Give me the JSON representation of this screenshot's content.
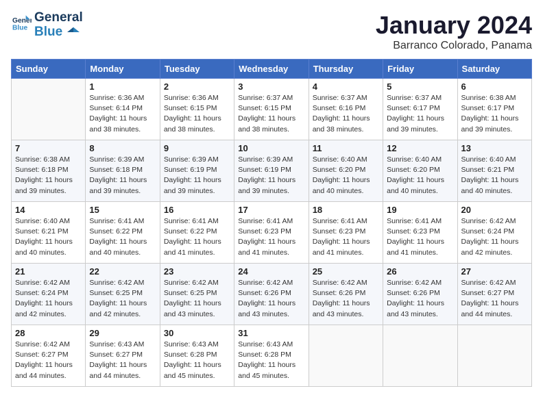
{
  "header": {
    "logo_line1": "General",
    "logo_line2": "Blue",
    "title": "January 2024",
    "subtitle": "Barranco Colorado, Panama"
  },
  "days_of_week": [
    "Sunday",
    "Monday",
    "Tuesday",
    "Wednesday",
    "Thursday",
    "Friday",
    "Saturday"
  ],
  "weeks": [
    [
      {
        "day": "",
        "sunrise": "",
        "sunset": "",
        "daylight": ""
      },
      {
        "day": "1",
        "sunrise": "Sunrise: 6:36 AM",
        "sunset": "Sunset: 6:14 PM",
        "daylight": "Daylight: 11 hours and 38 minutes."
      },
      {
        "day": "2",
        "sunrise": "Sunrise: 6:36 AM",
        "sunset": "Sunset: 6:15 PM",
        "daylight": "Daylight: 11 hours and 38 minutes."
      },
      {
        "day": "3",
        "sunrise": "Sunrise: 6:37 AM",
        "sunset": "Sunset: 6:15 PM",
        "daylight": "Daylight: 11 hours and 38 minutes."
      },
      {
        "day": "4",
        "sunrise": "Sunrise: 6:37 AM",
        "sunset": "Sunset: 6:16 PM",
        "daylight": "Daylight: 11 hours and 38 minutes."
      },
      {
        "day": "5",
        "sunrise": "Sunrise: 6:37 AM",
        "sunset": "Sunset: 6:17 PM",
        "daylight": "Daylight: 11 hours and 39 minutes."
      },
      {
        "day": "6",
        "sunrise": "Sunrise: 6:38 AM",
        "sunset": "Sunset: 6:17 PM",
        "daylight": "Daylight: 11 hours and 39 minutes."
      }
    ],
    [
      {
        "day": "7",
        "sunrise": "Sunrise: 6:38 AM",
        "sunset": "Sunset: 6:18 PM",
        "daylight": "Daylight: 11 hours and 39 minutes."
      },
      {
        "day": "8",
        "sunrise": "Sunrise: 6:39 AM",
        "sunset": "Sunset: 6:18 PM",
        "daylight": "Daylight: 11 hours and 39 minutes."
      },
      {
        "day": "9",
        "sunrise": "Sunrise: 6:39 AM",
        "sunset": "Sunset: 6:19 PM",
        "daylight": "Daylight: 11 hours and 39 minutes."
      },
      {
        "day": "10",
        "sunrise": "Sunrise: 6:39 AM",
        "sunset": "Sunset: 6:19 PM",
        "daylight": "Daylight: 11 hours and 39 minutes."
      },
      {
        "day": "11",
        "sunrise": "Sunrise: 6:40 AM",
        "sunset": "Sunset: 6:20 PM",
        "daylight": "Daylight: 11 hours and 40 minutes."
      },
      {
        "day": "12",
        "sunrise": "Sunrise: 6:40 AM",
        "sunset": "Sunset: 6:20 PM",
        "daylight": "Daylight: 11 hours and 40 minutes."
      },
      {
        "day": "13",
        "sunrise": "Sunrise: 6:40 AM",
        "sunset": "Sunset: 6:21 PM",
        "daylight": "Daylight: 11 hours and 40 minutes."
      }
    ],
    [
      {
        "day": "14",
        "sunrise": "Sunrise: 6:40 AM",
        "sunset": "Sunset: 6:21 PM",
        "daylight": "Daylight: 11 hours and 40 minutes."
      },
      {
        "day": "15",
        "sunrise": "Sunrise: 6:41 AM",
        "sunset": "Sunset: 6:22 PM",
        "daylight": "Daylight: 11 hours and 40 minutes."
      },
      {
        "day": "16",
        "sunrise": "Sunrise: 6:41 AM",
        "sunset": "Sunset: 6:22 PM",
        "daylight": "Daylight: 11 hours and 41 minutes."
      },
      {
        "day": "17",
        "sunrise": "Sunrise: 6:41 AM",
        "sunset": "Sunset: 6:23 PM",
        "daylight": "Daylight: 11 hours and 41 minutes."
      },
      {
        "day": "18",
        "sunrise": "Sunrise: 6:41 AM",
        "sunset": "Sunset: 6:23 PM",
        "daylight": "Daylight: 11 hours and 41 minutes."
      },
      {
        "day": "19",
        "sunrise": "Sunrise: 6:41 AM",
        "sunset": "Sunset: 6:23 PM",
        "daylight": "Daylight: 11 hours and 41 minutes."
      },
      {
        "day": "20",
        "sunrise": "Sunrise: 6:42 AM",
        "sunset": "Sunset: 6:24 PM",
        "daylight": "Daylight: 11 hours and 42 minutes."
      }
    ],
    [
      {
        "day": "21",
        "sunrise": "Sunrise: 6:42 AM",
        "sunset": "Sunset: 6:24 PM",
        "daylight": "Daylight: 11 hours and 42 minutes."
      },
      {
        "day": "22",
        "sunrise": "Sunrise: 6:42 AM",
        "sunset": "Sunset: 6:25 PM",
        "daylight": "Daylight: 11 hours and 42 minutes."
      },
      {
        "day": "23",
        "sunrise": "Sunrise: 6:42 AM",
        "sunset": "Sunset: 6:25 PM",
        "daylight": "Daylight: 11 hours and 43 minutes."
      },
      {
        "day": "24",
        "sunrise": "Sunrise: 6:42 AM",
        "sunset": "Sunset: 6:26 PM",
        "daylight": "Daylight: 11 hours and 43 minutes."
      },
      {
        "day": "25",
        "sunrise": "Sunrise: 6:42 AM",
        "sunset": "Sunset: 6:26 PM",
        "daylight": "Daylight: 11 hours and 43 minutes."
      },
      {
        "day": "26",
        "sunrise": "Sunrise: 6:42 AM",
        "sunset": "Sunset: 6:26 PM",
        "daylight": "Daylight: 11 hours and 43 minutes."
      },
      {
        "day": "27",
        "sunrise": "Sunrise: 6:42 AM",
        "sunset": "Sunset: 6:27 PM",
        "daylight": "Daylight: 11 hours and 44 minutes."
      }
    ],
    [
      {
        "day": "28",
        "sunrise": "Sunrise: 6:42 AM",
        "sunset": "Sunset: 6:27 PM",
        "daylight": "Daylight: 11 hours and 44 minutes."
      },
      {
        "day": "29",
        "sunrise": "Sunrise: 6:43 AM",
        "sunset": "Sunset: 6:27 PM",
        "daylight": "Daylight: 11 hours and 44 minutes."
      },
      {
        "day": "30",
        "sunrise": "Sunrise: 6:43 AM",
        "sunset": "Sunset: 6:28 PM",
        "daylight": "Daylight: 11 hours and 45 minutes."
      },
      {
        "day": "31",
        "sunrise": "Sunrise: 6:43 AM",
        "sunset": "Sunset: 6:28 PM",
        "daylight": "Daylight: 11 hours and 45 minutes."
      },
      {
        "day": "",
        "sunrise": "",
        "sunset": "",
        "daylight": ""
      },
      {
        "day": "",
        "sunrise": "",
        "sunset": "",
        "daylight": ""
      },
      {
        "day": "",
        "sunrise": "",
        "sunset": "",
        "daylight": ""
      }
    ]
  ]
}
